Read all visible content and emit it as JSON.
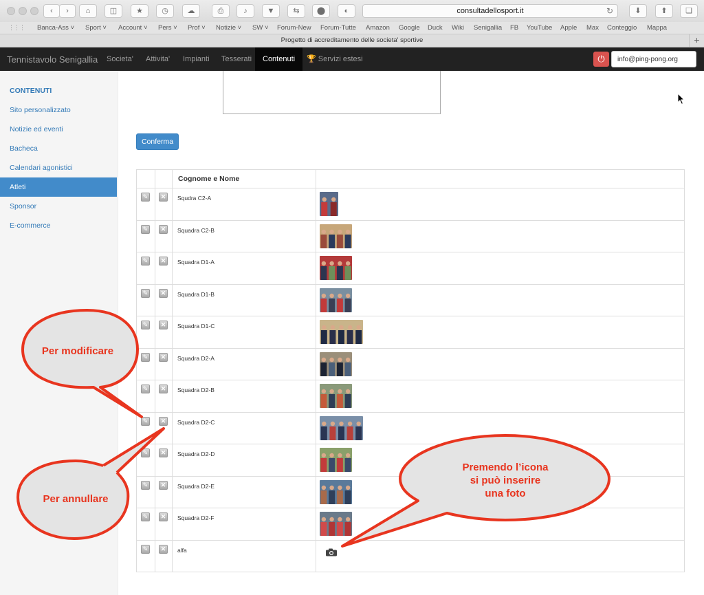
{
  "browser": {
    "url": "consultadellosport.it",
    "favorites": [
      "Banca-Ass",
      "Sport",
      "Account",
      "Pers",
      "Prof",
      "Notizie",
      "SW",
      "Forum-New",
      "Forum-Tutte",
      "Amazon",
      "Google",
      "Duck",
      "Wiki",
      "Senigallia",
      "FB",
      "YouTube",
      "Apple",
      "Max",
      "Conteggio",
      "Mappa"
    ],
    "favorites_with_menu": [
      "Banca-Ass",
      "Sport",
      "Account",
      "Pers",
      "Prof",
      "Notizie",
      "SW"
    ],
    "tab_title": "Progetto di accreditamento delle societa' sportive"
  },
  "navbar": {
    "brand": "Tennistavolo Senigallia",
    "items": [
      "Societa'",
      "Attivita'",
      "Impianti",
      "Tesserati",
      "Contenuti",
      "Servizi estesi"
    ],
    "active": "Contenuti",
    "email": "info@ping-pong.org",
    "power_icon": "power-icon",
    "trophy_icon": "trophy-icon"
  },
  "sidebar": {
    "heading": "CONTENUTI",
    "items": [
      "Sito personalizzato",
      "Notizie ed eventi",
      "Bacheca",
      "Calendari agonistici",
      "Atleti",
      "Sponsor",
      "E-commerce"
    ],
    "active": "Atleti"
  },
  "main": {
    "confirm_label": "Conferma",
    "table_header_name": "Cognome e Nome",
    "rows": [
      "Squdra C2-A",
      "Squadra C2-B",
      "Squadra D1-A",
      "Squadra D1-B",
      "Squadra D1-C",
      "Squadra D2-A",
      "Squadra D2-B",
      "Squadra D2-C",
      "Squadra D2-D",
      "Squadra D2-E",
      "Squadra D2-F",
      "alfa"
    ]
  },
  "callouts": {
    "modify": "Per modificare",
    "cancel": "Per annullare",
    "photo_lines": [
      "Premendo l’icona",
      "si può inserire",
      "una foto"
    ]
  },
  "colors": {
    "navbar_bg": "#222222",
    "primary": "#428bca",
    "link": "#337ab7",
    "danger": "#d9534f",
    "callout_border": "#e8351f",
    "callout_fill": "#e4e4e4"
  }
}
